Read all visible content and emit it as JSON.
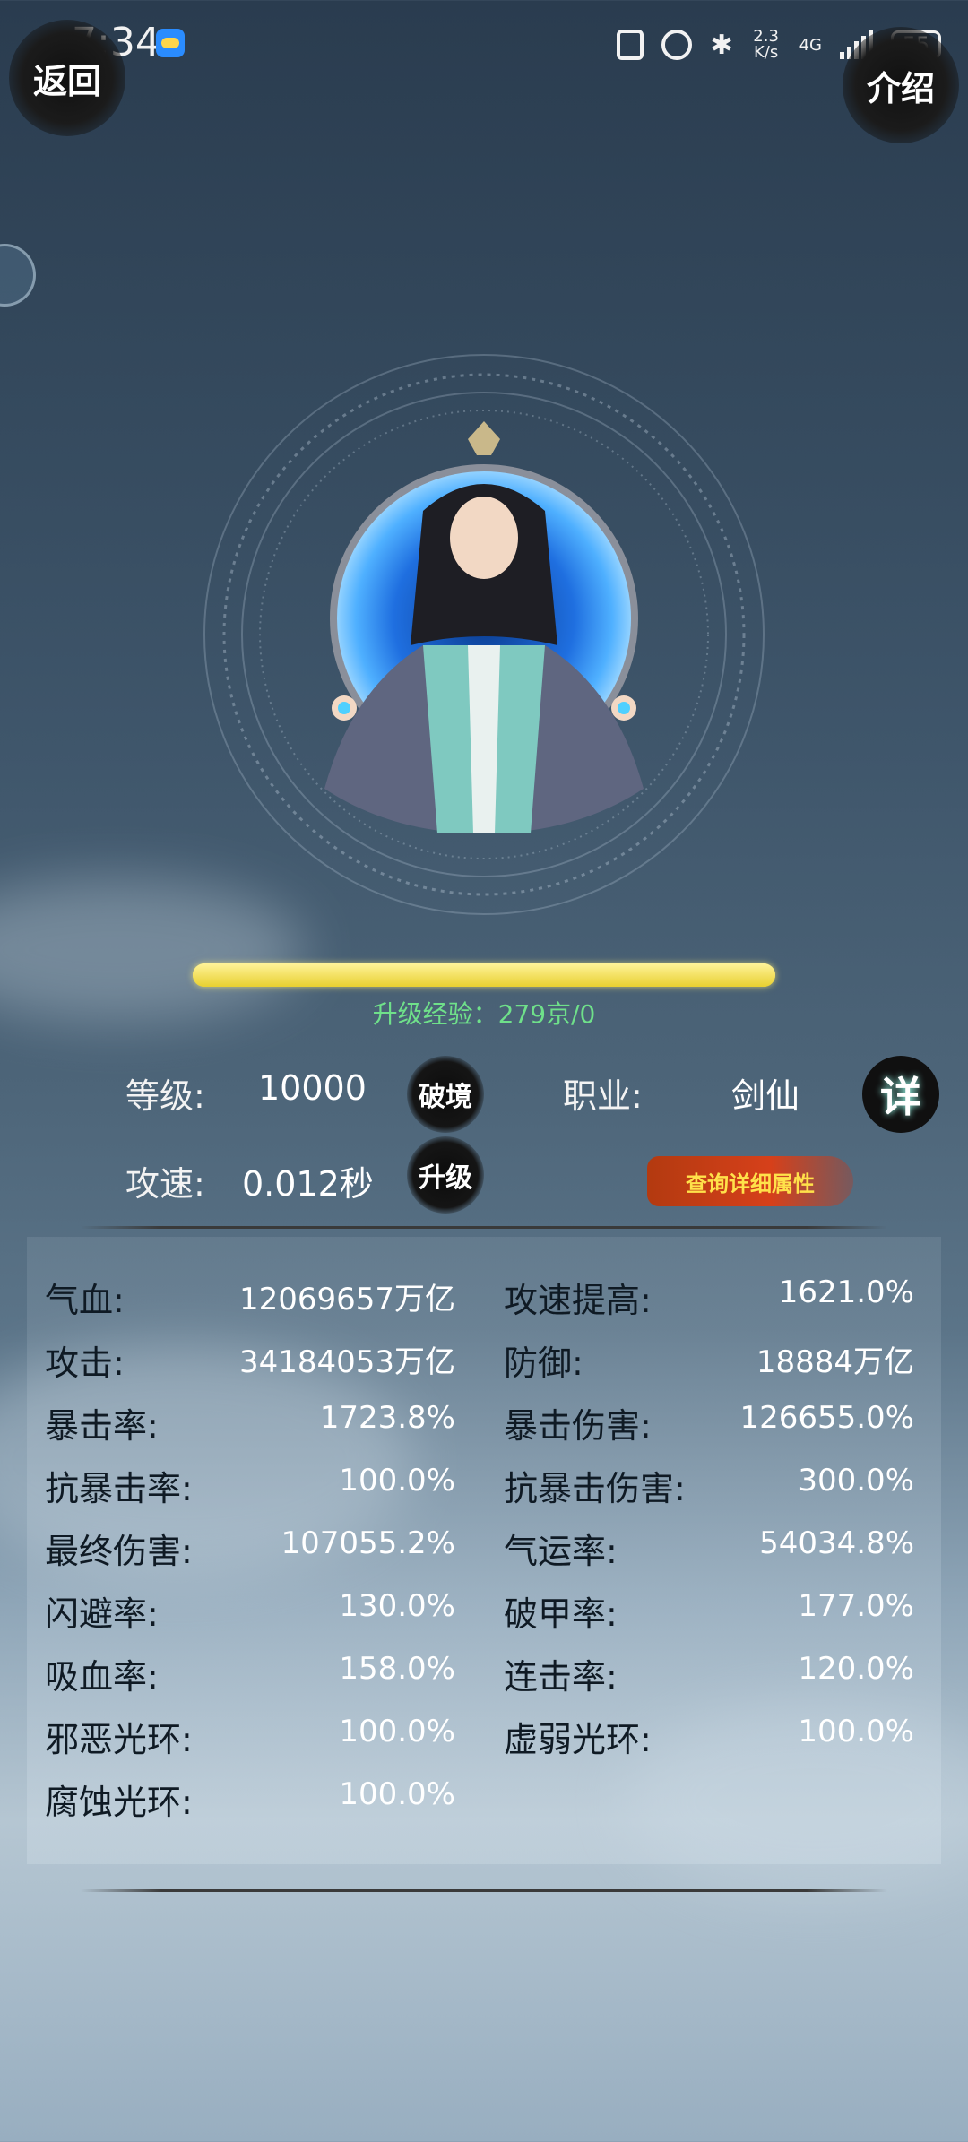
{
  "status_bar": {
    "time": "7:34",
    "network_speed": "2.3\nK/s",
    "network_type": "4G",
    "battery": "55"
  },
  "nav": {
    "back_label": "返回",
    "intro_label": "介绍"
  },
  "progress": {
    "fraction": 1.0,
    "exp_text": "升级经验：279京/0"
  },
  "info": {
    "level_label": "等级:",
    "level_value": "10000",
    "breakthrough_label": "破境",
    "class_label": "职业:",
    "class_value": "剑仙",
    "detail_label": "详",
    "speed_label": "攻速:",
    "speed_value": "0.012秒",
    "upgrade_label": "升级",
    "query_label": "查询详细属性"
  },
  "stats_left": [
    {
      "label": "气血:",
      "value": "12069657万亿"
    },
    {
      "label": "攻击:",
      "value": "34184053万亿"
    },
    {
      "label": "暴击率:",
      "value": "1723.8%"
    },
    {
      "label": "抗暴击率:",
      "value": "100.0%"
    },
    {
      "label": "最终伤害:",
      "value": "107055.2%"
    },
    {
      "label": "闪避率:",
      "value": "130.0%"
    },
    {
      "label": "吸血率:",
      "value": "158.0%"
    },
    {
      "label": "邪恶光环:",
      "value": "100.0%"
    },
    {
      "label": "腐蚀光环:",
      "value": "100.0%"
    }
  ],
  "stats_right": [
    {
      "label": "攻速提高:",
      "value": "1621.0%"
    },
    {
      "label": "防御:",
      "value": "18884万亿"
    },
    {
      "label": "暴击伤害:",
      "value": "126655.0%"
    },
    {
      "label": "抗暴击伤害:",
      "value": "300.0%"
    },
    {
      "label": "气运率:",
      "value": "54034.8%"
    },
    {
      "label": "破甲率:",
      "value": "177.0%"
    },
    {
      "label": "连击率:",
      "value": "120.0%"
    },
    {
      "label": "虚弱光环:",
      "value": "100.0%"
    }
  ]
}
